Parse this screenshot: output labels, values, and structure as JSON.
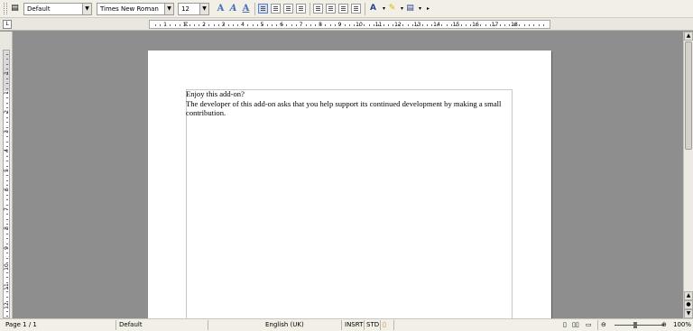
{
  "toolbar": {
    "paragraph_style": "Default",
    "font_name": "Times New Roman",
    "font_size": "12",
    "icons": [
      "styles-icon",
      "bold-icon",
      "italic-icon",
      "underline-icon",
      "align-left-icon",
      "align-center-icon",
      "align-right-icon",
      "justify-icon",
      "numbering-icon",
      "bullets-icon",
      "decrease-indent-icon",
      "increase-indent-icon",
      "font-color-icon",
      "highlight-icon",
      "background-color-icon"
    ]
  },
  "ruler": {
    "labels": [
      "1",
      "1",
      "2",
      "3",
      "4",
      "5",
      "6",
      "7",
      "8",
      "9",
      "10",
      "11",
      "12",
      "13",
      "14",
      "15",
      "16",
      "17",
      "18"
    ],
    "vertical_labels": [
      "1",
      "1",
      "2",
      "3",
      "4",
      "5",
      "6",
      "7",
      "8",
      "9",
      "10",
      "11",
      "12"
    ]
  },
  "document": {
    "line1": "Enjoy this add-on?",
    "line2": "The developer of this add-on asks that you help support its continued development by making a small contribution."
  },
  "status": {
    "page": "Page 1 / 1",
    "style": "Default",
    "language": "English (UK)",
    "insert_mode": "INSRT",
    "selection_mode": "STD",
    "zoom": "100%"
  }
}
